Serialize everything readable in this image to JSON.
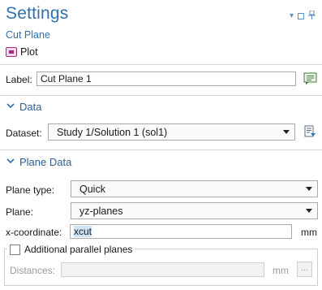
{
  "header": {
    "title": "Settings",
    "subtitle": "Cut Plane",
    "plot_label": "Plot"
  },
  "label_row": {
    "label": "Label:",
    "value": "Cut Plane 1"
  },
  "data_section": {
    "title": "Data",
    "dataset_label": "Dataset:",
    "dataset_value": "Study 1/Solution 1 (sol1)"
  },
  "plane_section": {
    "title": "Plane Data",
    "plane_type_label": "Plane type:",
    "plane_type_value": "Quick",
    "plane_label": "Plane:",
    "plane_value": "yz-planes",
    "xcoord_label": "x-coordinate:",
    "xcoord_value": "xcut",
    "xcoord_unit": "mm",
    "additional_label": "Additional parallel planes",
    "additional_checked": false,
    "distances_label": "Distances:",
    "distances_value": "",
    "distances_unit": "mm",
    "browse_label": "..."
  },
  "colors": {
    "accent": "#2f6fae",
    "section_title": "#2f5f93",
    "selection": "#cde3f7"
  }
}
